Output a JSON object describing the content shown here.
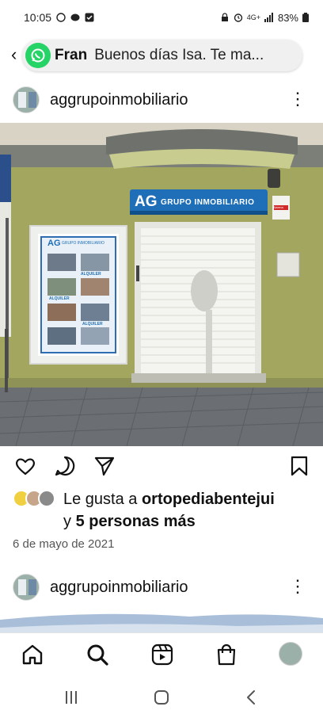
{
  "status_bar": {
    "time": "10:05",
    "battery": "83%",
    "network": "4G+"
  },
  "notification": {
    "sender": "Fran",
    "message": "Buenos días Isa. Te ma...",
    "app_icon": "whatsapp-icon"
  },
  "post": {
    "username": "aggrupoinmobiliario",
    "photo_sign_brand": "AG",
    "photo_sign_text": "GRUPO INMOBILIARIO",
    "photo_poster_brand": "AG",
    "photo_poster_text": "GRUPO INMOBILIARIO",
    "photo_poster_label_1": "ALQUILER",
    "photo_poster_label_2": "ALQUILER",
    "photo_poster_label_3": "ALQUILER",
    "photo_alarm_text": "Alarma",
    "likes_prefix": "Le gusta a ",
    "likes_user": "ortopediabentejui",
    "likes_and": "y ",
    "likes_others": "5 personas más",
    "date": "6 de mayo de 2021"
  },
  "next_post": {
    "username": "aggrupoinmobiliario"
  },
  "icons": {
    "like": "heart-icon",
    "comment": "comment-icon",
    "share": "send-icon",
    "save": "bookmark-icon",
    "home": "home-icon",
    "search": "search-icon",
    "reels": "reels-icon",
    "shop": "shop-icon",
    "more": "more-vertical-icon"
  },
  "colors": {
    "brand_blue": "#1f6fb8",
    "whatsapp_green": "#25D366",
    "wall_olive": "#9fa35c"
  }
}
